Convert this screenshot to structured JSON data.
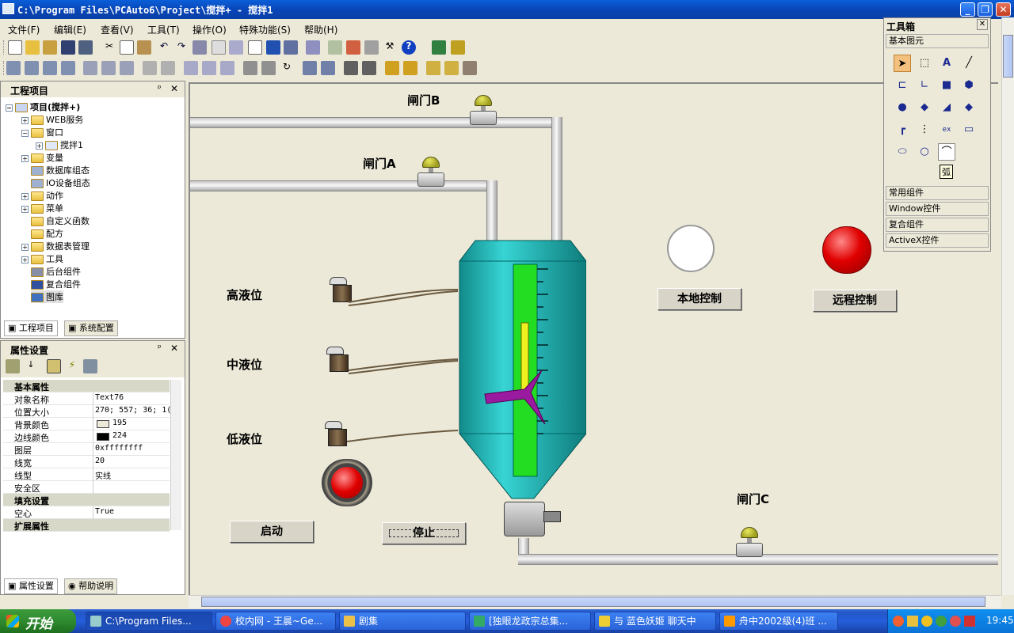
{
  "window": {
    "title": "C:\\Program Files\\PCAuto6\\Project\\搅拌+ - 搅拌1"
  },
  "menu": [
    "文件(F)",
    "编辑(E)",
    "查看(V)",
    "工具(T)",
    "操作(O)",
    "特殊功能(S)",
    "帮助(H)"
  ],
  "project_panel": {
    "title": "工程项目",
    "root": "项目(搅拌+)",
    "items": [
      "WEB服务",
      "窗口",
      "搅拌1",
      "变量",
      "数据库组态",
      "IO设备组态",
      "动作",
      "菜单",
      "自定义函数",
      "配方",
      "数据表管理",
      "工具",
      "后台组件",
      "复合组件",
      "图库"
    ],
    "tabs": [
      "工程项目",
      "系统配置"
    ]
  },
  "props_panel": {
    "title": "属性设置",
    "sections": {
      "basic": "基本属性",
      "fill": "填充设置",
      "ext": "扩展属性"
    },
    "rows": [
      {
        "key": "对象名称",
        "value": "Text76"
      },
      {
        "key": "位置大小",
        "value": "270; 557; 36; 1("
      },
      {
        "key": "背景颜色",
        "value": "195"
      },
      {
        "key": "边线颜色",
        "value": "224"
      },
      {
        "key": "图层",
        "value": "0xffffffff"
      },
      {
        "key": "线宽",
        "value": "20"
      },
      {
        "key": "线型",
        "value": "实线"
      },
      {
        "key": "安全区",
        "value": ""
      },
      {
        "key": "空心",
        "value": "True"
      }
    ],
    "tabs": [
      "属性设置",
      "帮助说明"
    ]
  },
  "canvas": {
    "labels": {
      "gate_b": "闸门B",
      "gate_a": "闸门A",
      "gate_c": "闸门C",
      "high_level": "高液位",
      "mid_level": "中液位",
      "low_level": "低液位"
    },
    "buttons": {
      "local_control": "本地控制",
      "remote_control": "远程控制",
      "start": "启动",
      "stop": "停止"
    },
    "colors": {
      "tank": "#20b0b0",
      "level_bar": "#22dd22",
      "indicator_red": "#e00000",
      "indicator_white": "#ffffff",
      "mixer": "#9a1aa0"
    }
  },
  "toolbox": {
    "title": "工具箱",
    "basic": "基本图元",
    "arc_tooltip": "弧",
    "sections": [
      "常用组件",
      "Window控件",
      "复合组件",
      "ActiveX控件"
    ]
  },
  "taskbar": {
    "start": "开始",
    "tasks": [
      "C:\\Program Files...",
      "校内网 - 王晨~Ge...",
      "剧集",
      "[独眼龙政宗总集...",
      "与 蓝色妖姬 聊天中",
      "舟中2002级(4)班 ..."
    ],
    "clock": "19:45"
  }
}
